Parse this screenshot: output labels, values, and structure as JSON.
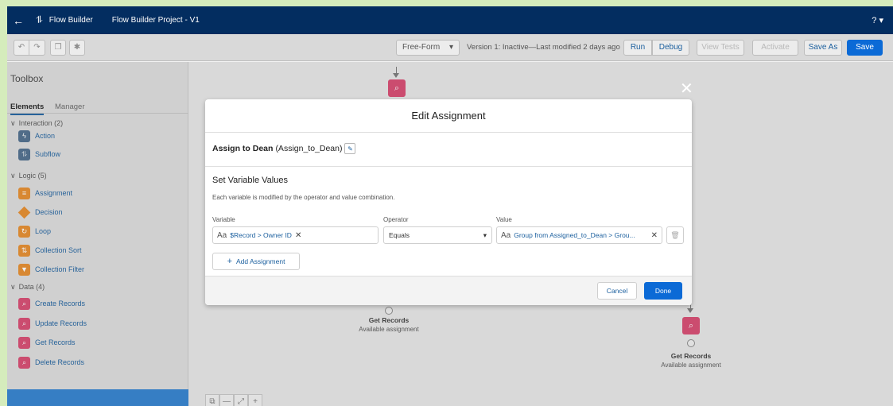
{
  "header": {
    "back_icon": "←",
    "flow_icon": "⥮",
    "app_title": "Flow Builder",
    "project_title": "Flow Builder Project - V1",
    "help_label": "? ▾"
  },
  "toolbar": {
    "undo_icon": "↶",
    "redo_icon": "↷",
    "copy_icon": "❐",
    "settings_icon": "✱",
    "layout_label": "Free-Form",
    "layout_caret": "▾",
    "version_text": "Version 1: Inactive—Last modified 2 days ago",
    "run_label": "Run",
    "debug_label": "Debug",
    "view_tests_label": "View Tests",
    "activate_label": "Activate",
    "save_as_label": "Save As",
    "save_label": "Save"
  },
  "toolbox": {
    "title": "Toolbox",
    "tabs": [
      "Elements",
      "Manager"
    ],
    "sections": [
      {
        "label": "Interaction (2)",
        "chevron": "∨",
        "items": [
          "Action",
          "Subflow"
        ]
      },
      {
        "label": "Logic (5)",
        "chevron": "∨",
        "items": [
          "Assignment",
          "Decision",
          "Loop",
          "Collection Sort",
          "Collection Filter"
        ]
      },
      {
        "label": "Data (4)",
        "chevron": "∨",
        "items": [
          "Create Records",
          "Update Records",
          "Get Records",
          "Delete Records"
        ]
      }
    ],
    "item_icons": {
      "action": "ϟ",
      "subflow": "⥮",
      "assignment": "≡",
      "loop": "↻",
      "collection_sort": "⇅",
      "collection_filter": "▼",
      "record": "⌕"
    }
  },
  "canvas": {
    "node_icon": "⌕",
    "nodes": [
      {
        "label": "Get Records",
        "sub": "Available assignment"
      },
      {
        "label": "Get Records",
        "sub": "Available assignment"
      }
    ],
    "zoom_icons": [
      "⧉",
      "—",
      "⤢",
      "+"
    ]
  },
  "modal": {
    "close_icon": "✕",
    "title": "Edit Assignment",
    "element_label": "Assign to Dean",
    "element_api": "(Assign_to_Dean)",
    "edit_icon": "✎",
    "section_title": "Set Variable Values",
    "section_desc": "Each variable is modified by the operator and value combination.",
    "variable_label": "Variable",
    "operator_label": "Operator",
    "value_label": "Value",
    "resource_icon": "Aa",
    "variable_value": "$Record > Owner ID",
    "operator_value": "Equals",
    "operator_caret": "▾",
    "value_value": "Group from Assigned_to_Dean > Grou...",
    "clear_icon": "✕",
    "delete_icon": "🗑",
    "add_plus": "+",
    "add_label": "Add Assignment",
    "cancel_label": "Cancel",
    "done_label": "Done"
  },
  "colors": {
    "header_bg": "#032d60",
    "brand_blue": "#0b6ad6",
    "link_blue": "#1b5f9e",
    "data_pink": "#d6466e",
    "logic_orange": "#e58a28",
    "screenshot_border": "#d5ecbc"
  }
}
